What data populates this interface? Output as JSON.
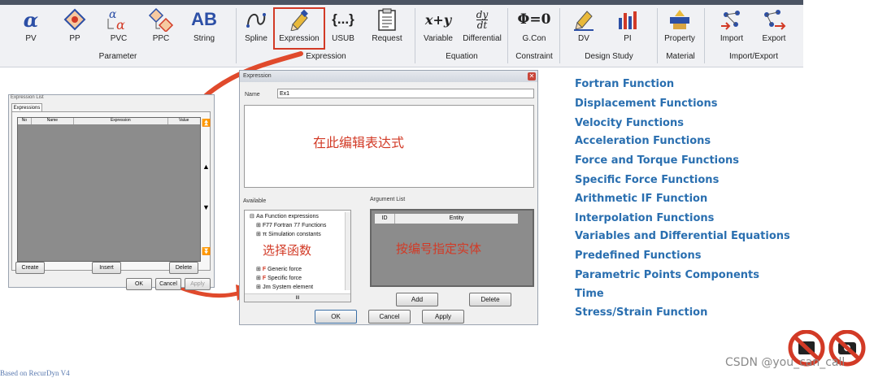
{
  "ribbon": {
    "tools": [
      {
        "id": "pv",
        "label": "PV",
        "icon": "alpha-icon"
      },
      {
        "id": "pp",
        "label": "PP",
        "icon": "pp-icon"
      },
      {
        "id": "pvc",
        "label": "PVC",
        "icon": "pvc-icon"
      },
      {
        "id": "ppc",
        "label": "PPC",
        "icon": "ppc-icon"
      },
      {
        "id": "string",
        "label": "String",
        "icon": "ab-icon"
      },
      {
        "id": "spline",
        "label": "Spline",
        "icon": "spline-icon"
      },
      {
        "id": "expression",
        "label": "Expression",
        "icon": "pencil-icon"
      },
      {
        "id": "usub",
        "label": "USUB",
        "icon": "braces-icon"
      },
      {
        "id": "request",
        "label": "Request",
        "icon": "clipboard-icon"
      },
      {
        "id": "variable",
        "label": "Variable",
        "icon": "xy-icon"
      },
      {
        "id": "differential",
        "label": "Differential",
        "icon": "dydt-icon"
      },
      {
        "id": "gcon",
        "label": "G.Con",
        "icon": "phi-icon"
      },
      {
        "id": "dv",
        "label": "DV",
        "icon": "pencil-icon"
      },
      {
        "id": "pi",
        "label": "PI",
        "icon": "bar-chart-icon"
      },
      {
        "id": "property",
        "label": "Property",
        "icon": "property-icon"
      },
      {
        "id": "import",
        "label": "Import",
        "icon": "import-icon"
      },
      {
        "id": "export",
        "label": "Export",
        "icon": "export-icon"
      }
    ],
    "groups": [
      "Parameter",
      "Expression",
      "Equation",
      "Constraint",
      "Design Study",
      "Material",
      "Import/Export"
    ],
    "icon_text": {
      "pv": "α",
      "string": "AB",
      "usub": "{...}",
      "variable": "x+y",
      "dy": "dy",
      "dt": "dt",
      "gcon": "Φ=0"
    }
  },
  "expression_list": {
    "title": "Expression List",
    "tab": "Expressions",
    "columns": [
      "No",
      "Name",
      "Expression",
      "Value"
    ],
    "side_buttons": [
      "⏫",
      "▲",
      "▼",
      "⏬"
    ],
    "buttons": [
      "Create",
      "Insert",
      "Delete"
    ],
    "footer_buttons": [
      "OK",
      "Cancel",
      "Apply"
    ]
  },
  "expression_dialog": {
    "title": "Expression",
    "name_label": "Name",
    "name_value": "Ex1",
    "editor_annotation": "在此编辑表达式",
    "available_label": "Available",
    "argument_list_label": "Argument List",
    "tree": [
      {
        "icon": "Aa",
        "label": "Function expressions",
        "prefix": "⊟"
      },
      {
        "icon": "F77",
        "label": "Fortran 77 Functions",
        "prefix": "⊞"
      },
      {
        "icon": "π",
        "label": "Simulation constants",
        "prefix": "⊞"
      },
      {
        "icon": "F",
        "label": "Generic force",
        "prefix": "⊞"
      },
      {
        "icon": "F",
        "label": "Specific force",
        "prefix": "⊞"
      },
      {
        "icon": "Jm",
        "label": "System element",
        "prefix": "⊞"
      }
    ],
    "tree_annotation": "选择函数",
    "argument_columns": [
      "ID",
      "Entity"
    ],
    "argument_annotation": "按编号指定实体",
    "argument_buttons": [
      "Add",
      "Delete"
    ],
    "footer_buttons": [
      "OK",
      "Cancel",
      "Apply"
    ],
    "scroll_label": "III"
  },
  "function_list": [
    "Fortran Function",
    "Displacement Functions",
    "Velocity Functions",
    "Acceleration Functions",
    "Force and Torque Functions",
    "Specific Force Functions",
    "Arithmetic IF Function",
    "Interpolation Functions",
    "Variables and Differential Equations",
    "Predefined Functions",
    "Parametric Points Components",
    "Time",
    "Stress/Strain Function"
  ],
  "footer": {
    "based_on": "Based on RecurDyn V4",
    "watermark": "CSDN @you_can_call"
  },
  "colors": {
    "highlight": "#d23a26",
    "arrow": "#e04a2c",
    "function_text": "#2a6fb0",
    "grid_bg": "#8c8c8c"
  }
}
